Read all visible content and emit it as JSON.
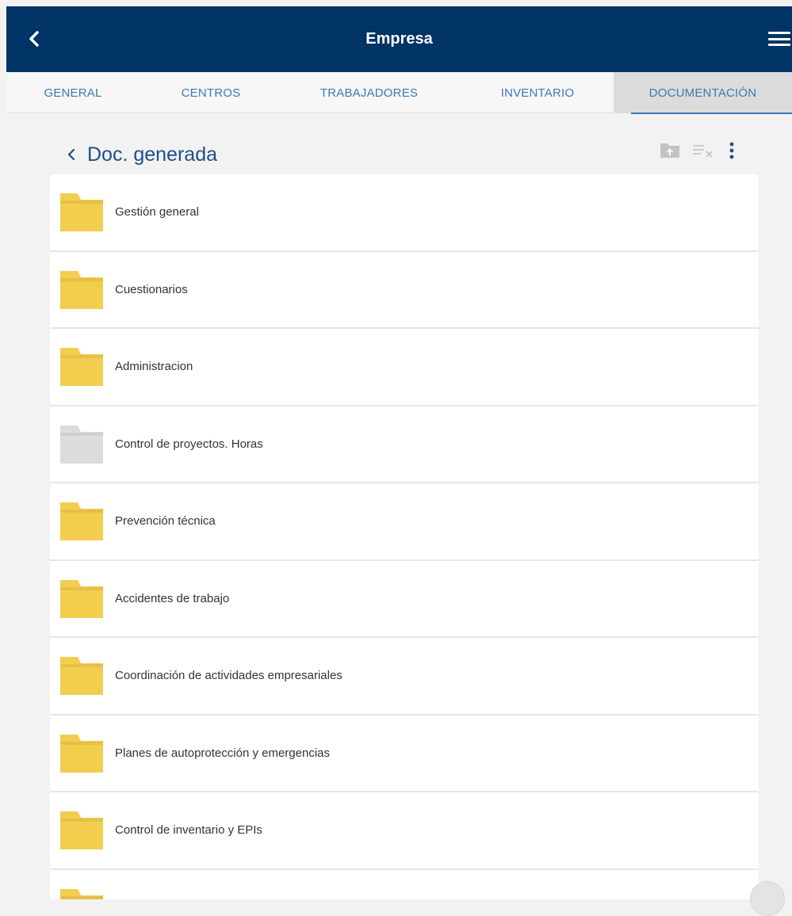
{
  "header": {
    "title": "Empresa",
    "back_icon": "chevron-left-icon",
    "menu_icon": "hamburger-menu-icon"
  },
  "tabs": [
    {
      "label": "GENERAL",
      "active": false
    },
    {
      "label": "CENTROS",
      "active": false
    },
    {
      "label": "TRABAJADORES",
      "active": false
    },
    {
      "label": "INVENTARIO",
      "active": false
    },
    {
      "label": "DOCUMENTACIÓN",
      "active": true
    }
  ],
  "breadcrumb": {
    "label": "Doc. generada",
    "icon": "chevron-left-icon"
  },
  "toolbar": {
    "icons": [
      "folder-upload-icon",
      "clear-filter-icon",
      "more-vertical-icon"
    ]
  },
  "folders": [
    {
      "name": "Gestión general",
      "color": "#f3cd4d"
    },
    {
      "name": "Cuestionarios",
      "color": "#f3cd4d"
    },
    {
      "name": "Administracion",
      "color": "#f3cd4d"
    },
    {
      "name": "Control de proyectos. Horas",
      "color": "#dcdcdc"
    },
    {
      "name": "Prevención técnica",
      "color": "#f3cd4d"
    },
    {
      "name": "Accidentes de trabajo",
      "color": "#f3cd4d"
    },
    {
      "name": "Coordinación de actividades empresariales",
      "color": "#f3cd4d"
    },
    {
      "name": "Planes de autoprotección y emergencias",
      "color": "#f3cd4d"
    },
    {
      "name": "Control de inventario y EPIs",
      "color": "#f3cd4d"
    },
    {
      "name": "",
      "color": "#f3cd4d"
    }
  ],
  "colors": {
    "header_bg": "#003366",
    "tab_text": "#3f78b0",
    "folder_yellow": "#f3cd4d",
    "folder_grey": "#dcdcdc"
  }
}
